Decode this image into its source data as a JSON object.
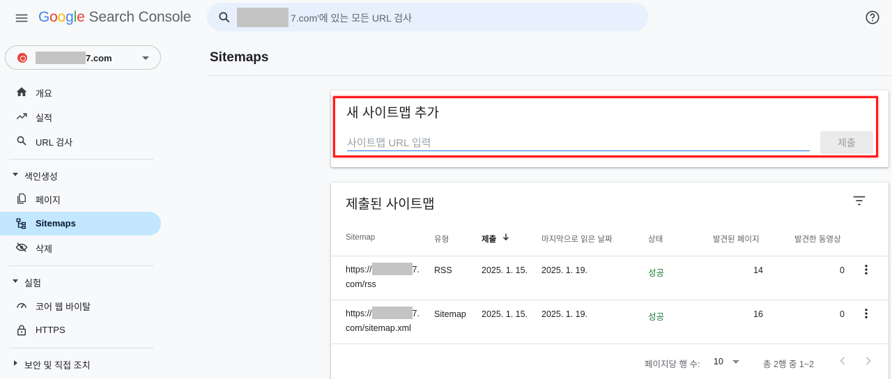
{
  "app": {
    "logo_letters": [
      "G",
      "o",
      "o",
      "g",
      "l",
      "e"
    ],
    "product": "Search Console"
  },
  "search": {
    "suffix_text": "7.com'에 있는 모든 URL 검사"
  },
  "property": {
    "domain_suffix": "7.com"
  },
  "sidebar": {
    "items": [
      {
        "label": "개요",
        "icon": "home-icon"
      },
      {
        "label": "실적",
        "icon": "trending-up-icon"
      },
      {
        "label": "URL 검사",
        "icon": "search-icon"
      }
    ],
    "sections": [
      {
        "label": "색인생성",
        "items": [
          {
            "label": "페이지",
            "icon": "pages-icon"
          },
          {
            "label": "Sitemaps",
            "icon": "sitemap-icon",
            "active": true
          },
          {
            "label": "삭제",
            "icon": "visibility-off-icon"
          }
        ]
      },
      {
        "label": "실험",
        "items": [
          {
            "label": "코어 웹 바이탈",
            "icon": "speed-icon"
          },
          {
            "label": "HTTPS",
            "icon": "lock-icon"
          }
        ]
      },
      {
        "label": "보안 및 직접 조치",
        "collapsed": true
      }
    ]
  },
  "page": {
    "title": "Sitemaps"
  },
  "add_sitemap": {
    "title": "새 사이트맵 추가",
    "placeholder": "사이트맵 URL 입력",
    "value": "",
    "submit_label": "제출"
  },
  "submitted": {
    "title": "제출된 사이트맵",
    "columns": [
      "Sitemap",
      "유형",
      "제출",
      "마지막으로 읽은 날짜",
      "상태",
      "발견된 페이지",
      "발견한 동영상"
    ],
    "rows": [
      {
        "url_prefix": "https://",
        "url_mid": "7.",
        "url_rest": "com/rss",
        "type": "RSS",
        "submitted": "2025. 1. 15.",
        "last_read": "2025. 1. 19.",
        "status": "성공",
        "pages": "14",
        "videos": "0"
      },
      {
        "url_prefix": "https://",
        "url_mid": "7.",
        "url_rest": "com/sitemap.xml",
        "type": "Sitemap",
        "submitted": "2025. 1. 15.",
        "last_read": "2025. 1. 19.",
        "status": "성공",
        "pages": "16",
        "videos": "0"
      }
    ],
    "footer": {
      "rows_per_page_label": "페이지당 행 수:",
      "rows_per_page": "10",
      "range_text": "총 2행 중 1~2"
    }
  },
  "colors": {
    "accent": "#1a73e8",
    "active_nav": "#c2e7ff",
    "success": "#188038",
    "highlight": "#ff1a1a"
  }
}
